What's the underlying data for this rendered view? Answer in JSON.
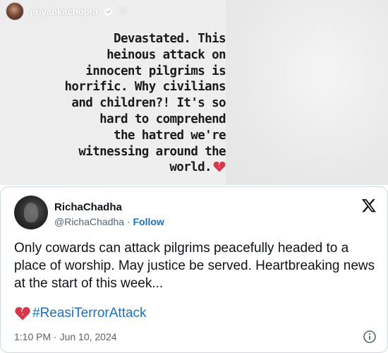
{
  "story": {
    "username": "priyankachopra",
    "time": "3h",
    "lines": [
      "Devastated. This",
      "heinous attack on",
      "innocent pilgrims is",
      "horrific. Why civilians",
      "and children?! It's so",
      "hard to comprehend",
      "the hatred we're",
      "witnessing around the",
      "world."
    ],
    "icons": {
      "verified": "verified-badge-icon",
      "emoji": "broken-heart-icon"
    }
  },
  "tweet": {
    "display_name": "RichaChadha",
    "handle": "@RichaChadha",
    "separator": " · ",
    "follow_label": "Follow",
    "body": "Only cowards can attack pilgrims peacefully headed to a place of worship. May justice be served. Heartbreaking news at the start of this week...",
    "hashtag": "#ReasiTerrorAttack",
    "timestamp": "1:10 PM · Jun 10, 2024",
    "icons": {
      "brand": "x-logo-icon",
      "info": "info-icon",
      "hashtag_emoji": "broken-heart-icon"
    }
  },
  "colors": {
    "link": "#1d6fbf",
    "secondary_text": "#536471",
    "primary_text": "#0f1419",
    "broken_heart": "#d8384a"
  }
}
